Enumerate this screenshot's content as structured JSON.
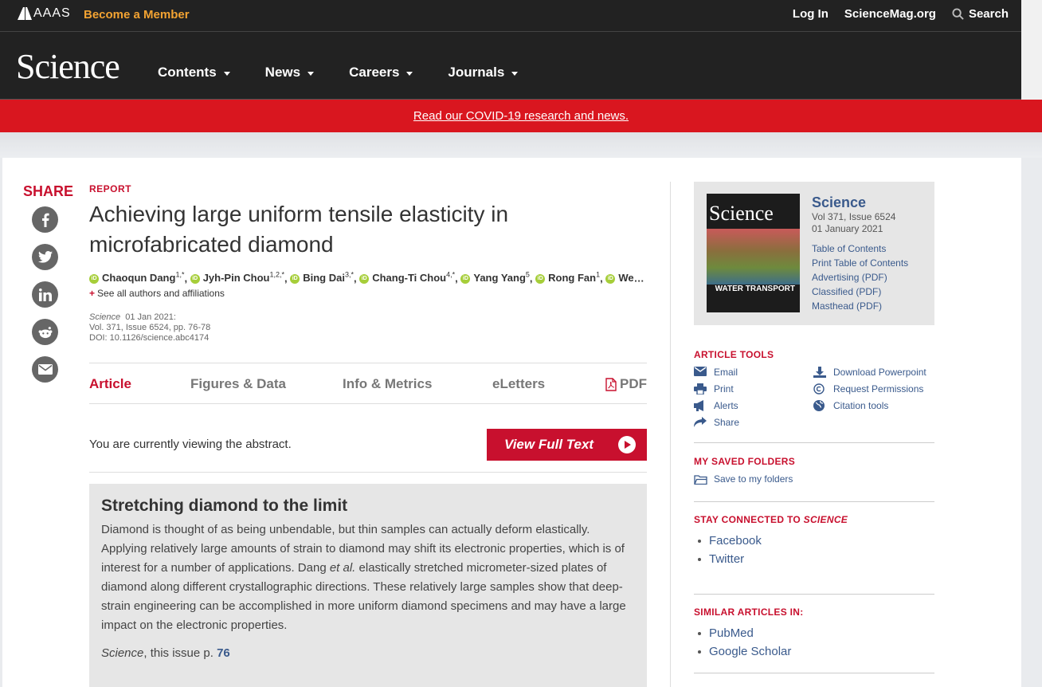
{
  "header": {
    "aaas": "AAAS",
    "become_member": "Become a Member",
    "login": "Log In",
    "sciencemag": "ScienceMag.org",
    "search": "Search"
  },
  "nav": {
    "logo": "Science",
    "items": [
      "Contents",
      "News",
      "Careers",
      "Journals"
    ]
  },
  "banner": {
    "text": "Read our COVID-19 research and news."
  },
  "share": {
    "title": "SHARE",
    "icons": [
      "facebook-icon",
      "twitter-icon",
      "linkedin-icon",
      "reddit-icon",
      "email-icon"
    ]
  },
  "article": {
    "kicker": "REPORT",
    "title": "Achieving large uniform tensile elasticity in microfabricated diamond",
    "authors": [
      {
        "name": "Chaoqun Dang",
        "sup": "1,*"
      },
      {
        "name": "Jyh-Pin Chou",
        "sup": "1,2,*"
      },
      {
        "name": "Bing Dai",
        "sup": "3,*"
      },
      {
        "name": "Chang-Ti Chou",
        "sup": "4,*"
      },
      {
        "name": "Yang Yang",
        "sup": "5"
      },
      {
        "name": "Rong Fan",
        "sup": "1"
      },
      {
        "name": "Weitong L...",
        "sup": ""
      }
    ],
    "see_all": "See all authors and affiliations",
    "journal": "Science",
    "date": "01 Jan 2021:",
    "volume": "Vol. 371, Issue 6524, pp. 76-78",
    "doi": "DOI: 10.1126/science.abc4174"
  },
  "tabs": {
    "article": "Article",
    "figures": "Figures & Data",
    "info": "Info & Metrics",
    "eletters": "eLetters",
    "pdf": "PDF"
  },
  "viewing": {
    "text": "You are currently viewing the abstract.",
    "button": "View Full Text"
  },
  "abstract": {
    "title": "Stretching diamond to the limit",
    "body_1": "Diamond is thought of as being unbendable, but thin samples can actually deform elastically. Applying relatively large amounts of strain to diamond may shift its electronic properties, which is of interest for a number of applications. Dang ",
    "body_etal": "et al.",
    "body_2": " elastically stretched micrometer-sized plates of diamond along different crystallographic directions. These relatively large samples show that deep-strain engineering can be accomplished in more uniform diamond specimens and may have a large impact on the electronic properties.",
    "cite_journal": "Science",
    "cite_text": ", this issue p. ",
    "cite_page": "76"
  },
  "issue": {
    "cover_logo": "Science",
    "cover_text": "WATER TRANSPORT",
    "title": "Science",
    "vol": "Vol 371, Issue 6524",
    "date": "01 January 2021",
    "links": [
      "Table of Contents",
      "Print Table of Contents",
      "Advertising (PDF)",
      "Classified (PDF)",
      "Masthead (PDF)"
    ]
  },
  "tools": {
    "heading": "ARTICLE TOOLS",
    "items": [
      "Email",
      "Download Powerpoint",
      "Print",
      "Request Permissions",
      "Alerts",
      "Citation tools",
      "Share"
    ]
  },
  "saved": {
    "heading": "MY SAVED FOLDERS",
    "link": "Save to my folders"
  },
  "stay": {
    "heading": "STAY CONNECTED TO ",
    "heading_em": "SCIENCE",
    "links": [
      "Facebook",
      "Twitter"
    ]
  },
  "similar": {
    "heading": "SIMILAR ARTICLES IN:",
    "links": [
      "PubMed",
      "Google Scholar"
    ]
  },
  "colors": {
    "brand_red": "#c8102e",
    "header_dark": "#222222",
    "link_blue": "#3a5a8c",
    "member_orange": "#f3a332"
  }
}
